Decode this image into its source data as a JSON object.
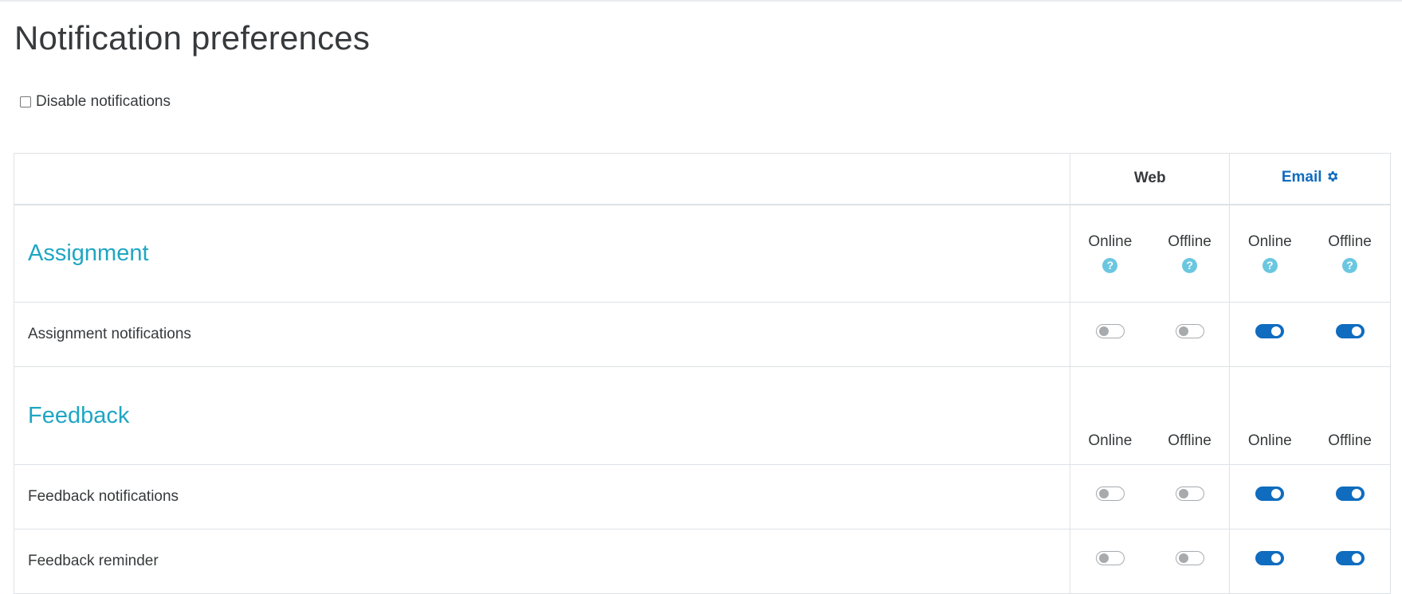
{
  "page": {
    "title": "Notification preferences",
    "disable_label": "Disable notifications",
    "disable_checked": false
  },
  "table": {
    "processors": [
      {
        "label": "Web",
        "is_link": false,
        "icon": null
      },
      {
        "label": "Email",
        "is_link": true,
        "icon": "gear-icon"
      }
    ],
    "state_labels": {
      "online": "Online",
      "offline": "Offline"
    },
    "sections": [
      {
        "title": "Assignment",
        "show_help": true,
        "items": [
          {
            "label": "Assignment notifications",
            "web_online": false,
            "web_offline": false,
            "email_online": true,
            "email_offline": true
          }
        ]
      },
      {
        "title": "Feedback",
        "show_help": false,
        "items": [
          {
            "label": "Feedback notifications",
            "web_online": false,
            "web_offline": false,
            "email_online": true,
            "email_offline": true
          },
          {
            "label": "Feedback reminder",
            "web_online": false,
            "web_offline": false,
            "email_online": true,
            "email_offline": true
          }
        ]
      }
    ]
  },
  "colors": {
    "accent": "#0f6cbf",
    "section_title": "#1fa6c3",
    "help_icon": "#6bc7e0",
    "toggle_off": "#a7abae"
  }
}
